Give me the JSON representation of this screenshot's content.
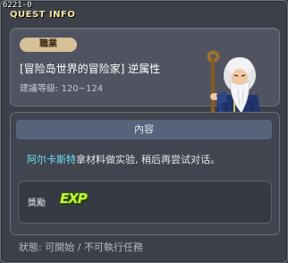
{
  "window": {
    "quest_id": "6221-0",
    "title": "QUEST INFO"
  },
  "quest": {
    "tag": "職業",
    "name": "[冒险岛世界的冒险家] 逆属性",
    "level": "建議等級: 120~124"
  },
  "content": {
    "header": "內容",
    "npc_name": "阿尔卡斯特",
    "description_rest": "拿材料做实验, 稍后再尝试对话。"
  },
  "reward": {
    "label": "獎勵",
    "exp_text": "EXP"
  },
  "status": "狀態: 可開始 / 不可執行任務",
  "colors": {
    "npc_name": "#6fe0ef",
    "tag_bg": "#d6c09a",
    "title": "#f5e4a0",
    "exp": "#c8f23a"
  },
  "icons": {
    "npc": "wizard-npc-portrait",
    "reward": "exp-icon"
  }
}
